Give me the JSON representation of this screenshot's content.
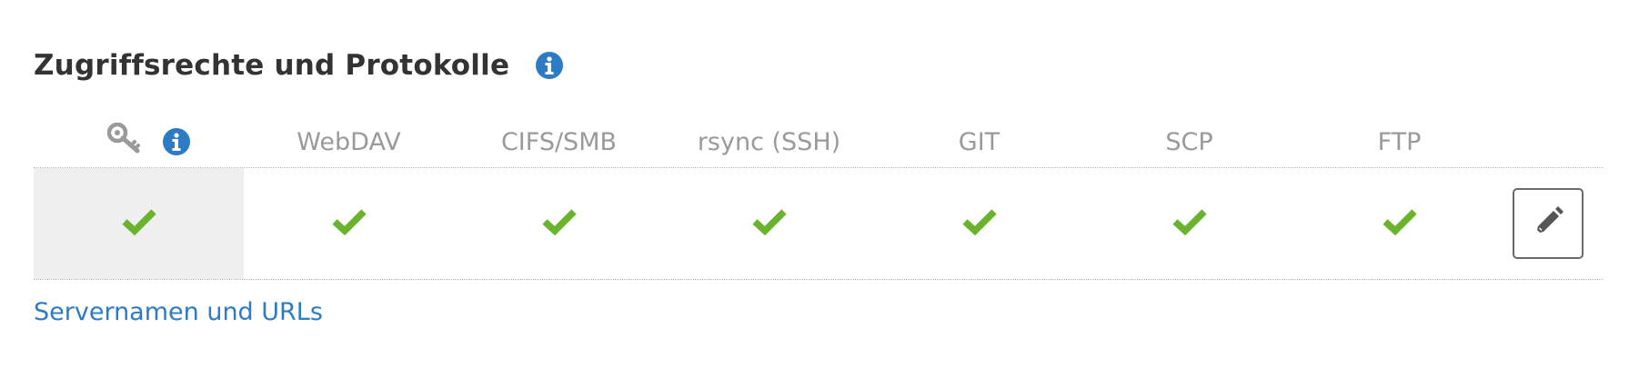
{
  "section": {
    "title": "Zugriffsrechte und Protokolle",
    "info_icon": "info-icon"
  },
  "table": {
    "key_column_icon": "key-icon",
    "columns": [
      "WebDAV",
      "CIFS/SMB",
      "rsync (SSH)",
      "GIT",
      "SCP",
      "FTP"
    ],
    "row": {
      "key_enabled": true,
      "values": [
        true,
        true,
        true,
        true,
        true,
        true
      ],
      "check_icon": "check-icon",
      "edit_icon": "pencil-icon"
    }
  },
  "link": {
    "label": "Servernamen und URLs"
  },
  "colors": {
    "info_blue": "#2d7bc4",
    "check_green": "#6ab42d",
    "link_blue": "#2d7bc4",
    "highlight_bg": "#efefef",
    "header_gray": "#9a9a9a"
  }
}
